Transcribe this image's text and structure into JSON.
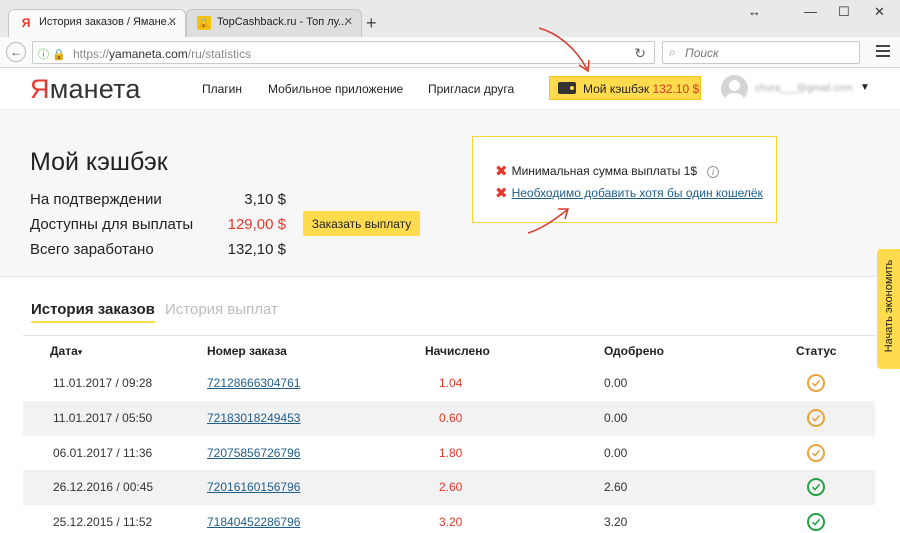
{
  "browser": {
    "tabs": [
      {
        "title": "История заказов / Ямане...",
        "favicon": "Я",
        "active": true
      },
      {
        "title": "TopCashback.ru - Топ лу...",
        "favicon": "🔒",
        "active": false
      }
    ],
    "url_scheme": "https://",
    "url_host": "yamaneta.com",
    "url_path": "/ru/statistics",
    "search_placeholder": "Поиск"
  },
  "header": {
    "logo_first": "Я",
    "logo_rest": "манета",
    "nav": [
      "Плагин",
      "Мобильное приложение",
      "Пригласи друга"
    ],
    "cashback_label": "Мой кэшбэк",
    "cashback_amount": "132.10 $",
    "user_name": "chura___@gmail.com"
  },
  "balance": {
    "title": "Мой кэшбэк",
    "rows": [
      {
        "label": "На подтверждении",
        "value": "3,10 $",
        "highlight": false
      },
      {
        "label": "Доступны для выплаты",
        "value": "129,00 $",
        "highlight": true
      },
      {
        "label": "Всего заработано",
        "value": "132,10 $",
        "highlight": false
      }
    ],
    "payout_button": "Заказать выплату"
  },
  "warnings": {
    "min_payout": "Минимальная сумма выплаты 1$",
    "add_wallet": "Необходимо добавить хотя бы один кошелёк"
  },
  "history": {
    "tabs": [
      "История заказов",
      "История выплат"
    ],
    "columns": [
      "Дата",
      "Номер заказа",
      "Начислено",
      "Одобрено",
      "Статус"
    ],
    "sort_indicator": "▾",
    "rows": [
      {
        "date": "11.01.2017 / 09:28",
        "order": "72128666304761",
        "accrued": "1.04",
        "approved": "0.00",
        "status": "pending"
      },
      {
        "date": "11.01.2017 / 05:50",
        "order": "72183018249453",
        "accrued": "0.60",
        "approved": "0.00",
        "status": "pending"
      },
      {
        "date": "06.01.2017 / 11:36",
        "order": "72075856726796",
        "accrued": "1.80",
        "approved": "0.00",
        "status": "pending"
      },
      {
        "date": "26.12.2016 / 00:45",
        "order": "72016160156796",
        "accrued": "2.60",
        "approved": "2.60",
        "status": "approved"
      },
      {
        "date": "25.12.2015 / 11:52",
        "order": "71840452286796",
        "accrued": "3.20",
        "approved": "3.20",
        "status": "approved"
      }
    ]
  },
  "side_widget": {
    "label": "Начать экономить"
  },
  "colors": {
    "brand_red": "#e5372b",
    "brand_yellow": "#ffdb4d",
    "link_blue": "#1f5d8a",
    "pending_orange": "#e8a33d",
    "approved_green": "#25a244"
  }
}
